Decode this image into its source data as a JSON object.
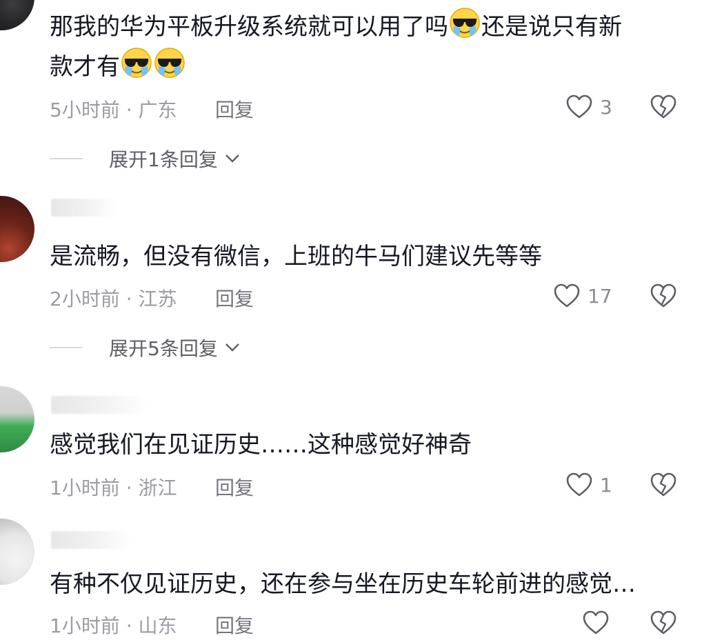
{
  "comments": [
    {
      "text_before_emoji": "那我的华为平板升级系统就可以用了吗",
      "text_after_emoji": "还是说只有新",
      "line2": "款才有",
      "time": "5小时前",
      "location": "广东",
      "reply_label": "回复",
      "likes": "3",
      "expand_label": "展开1条回复",
      "emoji_name": "sunglasses-teary-emoji"
    },
    {
      "text": "是流畅，但没有微信，上班的牛马们建议先等等",
      "time": "2小时前",
      "location": "江苏",
      "reply_label": "回复",
      "likes": "17",
      "expand_label": "展开5条回复"
    },
    {
      "text": "感觉我们在见证历史……这种感觉好神奇",
      "time": "1小时前",
      "location": "浙江",
      "reply_label": "回复",
      "likes": "1"
    },
    {
      "text": "有种不仅见证历史，还在参与坐在历史车轮前进的感觉…",
      "time": "1小时前",
      "location": "山东",
      "reply_label": "回复",
      "likes": ""
    }
  ],
  "meta_separator": " · ",
  "colors": {
    "text": "#161823",
    "meta": "#9b9ca3",
    "reply": "#74757c",
    "icon": "#5c5d64"
  },
  "icons": [
    "heart-outline-icon",
    "broken-heart-icon",
    "chevron-down-icon"
  ]
}
